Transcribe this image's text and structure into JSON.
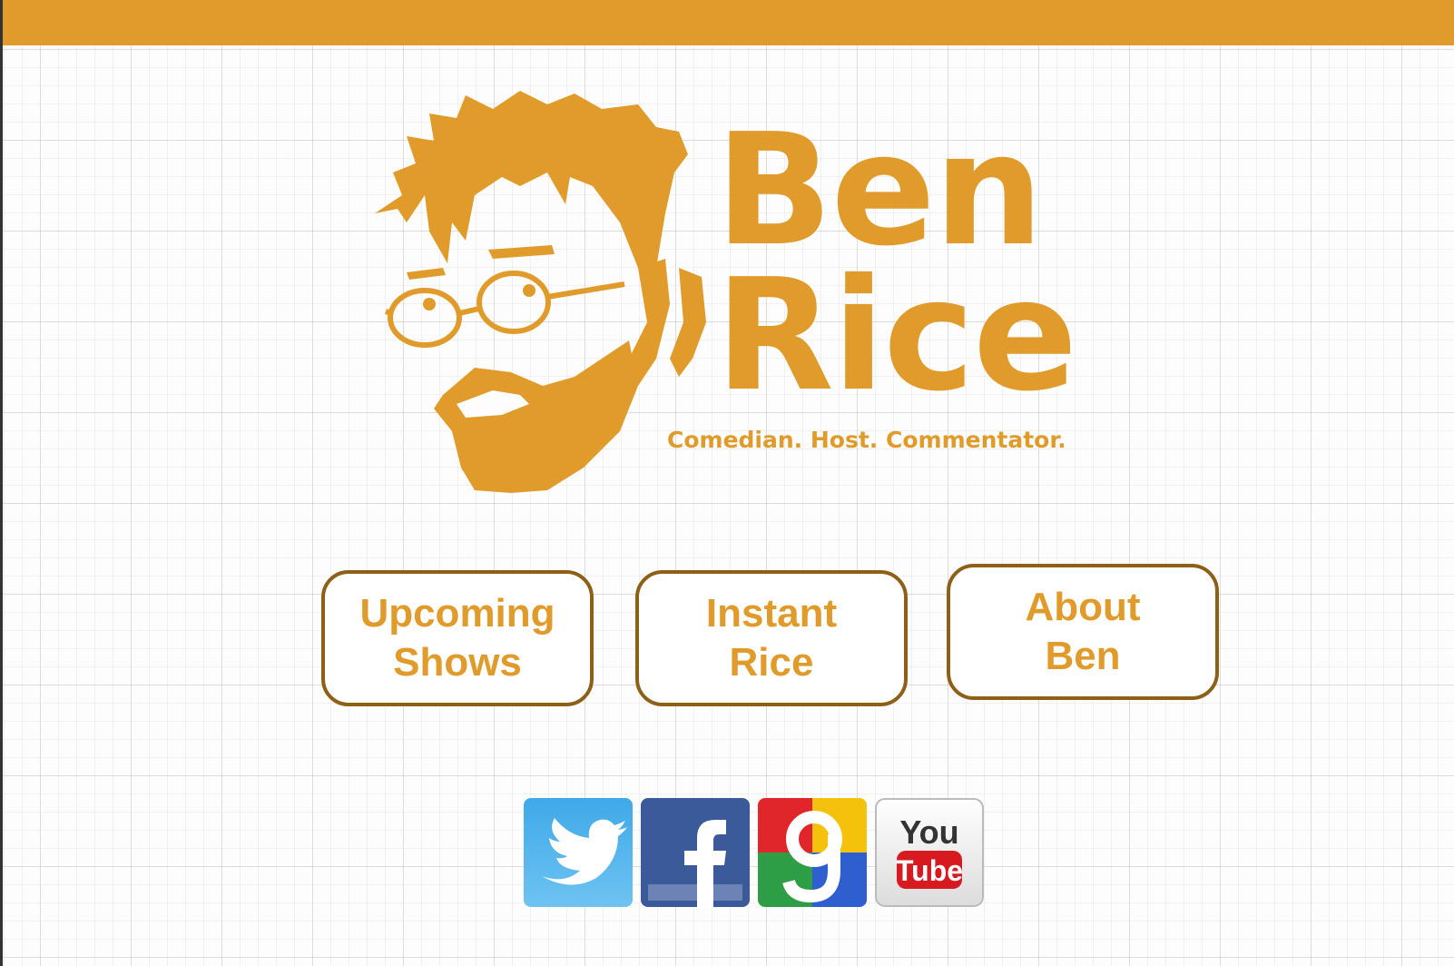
{
  "header": {
    "brand_first": "Ben",
    "brand_last": "Rice",
    "tagline": "Comedian. Host. Commentator."
  },
  "nav": {
    "upcoming_label": "Upcoming\nShows",
    "instant_label": "Instant\nRice",
    "about_label": "About\nBen"
  },
  "social": [
    {
      "icon": "twitter-icon"
    },
    {
      "icon": "facebook-icon"
    },
    {
      "icon": "google-plus-icon"
    },
    {
      "icon": "youtube-icon",
      "text_top": "You",
      "text_bottom": "Tube"
    }
  ],
  "colors": {
    "accent": "#e09b2b",
    "button_border": "#8e6017"
  }
}
